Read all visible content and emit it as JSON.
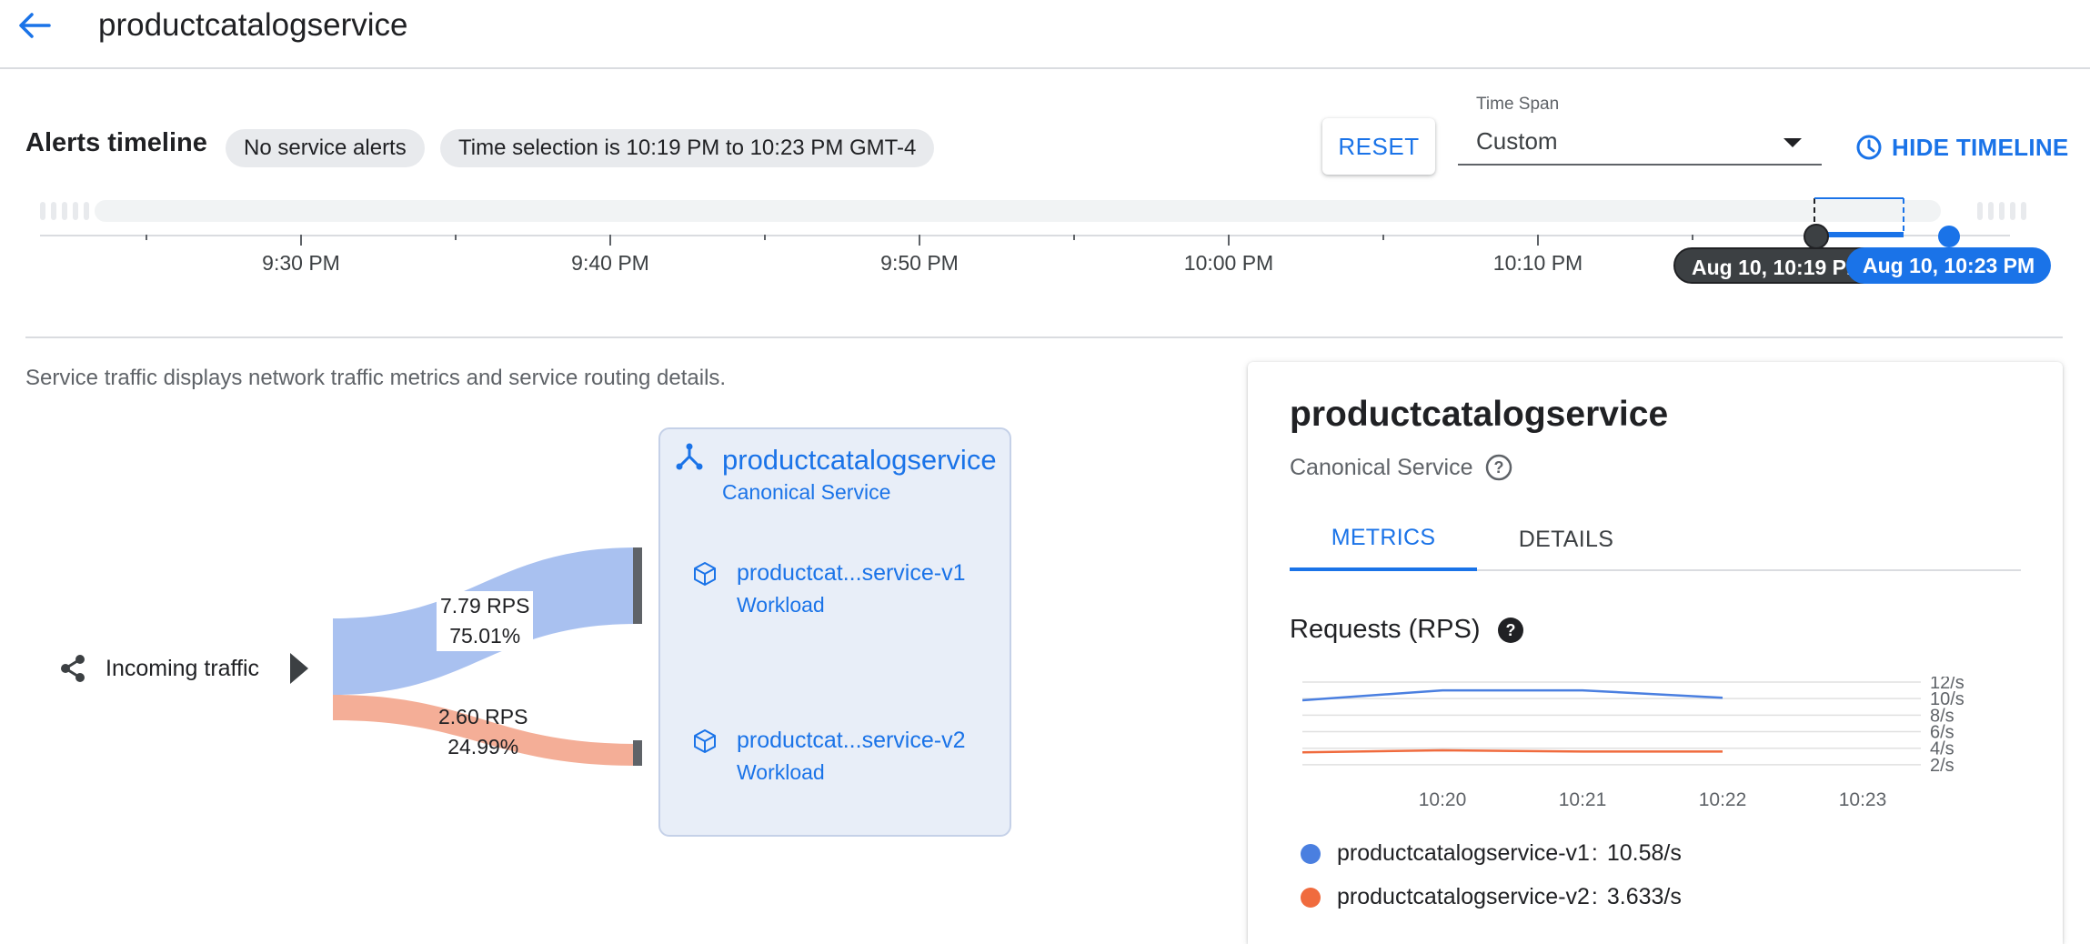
{
  "header": {
    "title": "productcatalogservice"
  },
  "alerts": {
    "title": "Alerts timeline",
    "chip_alerts": "No service alerts",
    "chip_selection": "Time selection is 10:19 PM to 10:23 PM GMT-4",
    "reset_label": "RESET",
    "timespan_label": "Time Span",
    "timespan_value": "Custom",
    "hide_timeline_label": "HIDE TIMELINE"
  },
  "timeline": {
    "ticks": [
      "9:30 PM",
      "9:40 PM",
      "9:50 PM",
      "10:00 PM",
      "10:10 PM"
    ],
    "start_handle": "Aug 10, 10:19 PM",
    "end_handle": "Aug 10, 10:23 PM"
  },
  "traffic": {
    "description": "Service traffic displays network traffic metrics and service routing details.",
    "incoming_label": "Incoming traffic",
    "flow1_rps": "7.79 RPS",
    "flow1_pct": "75.01%",
    "flow2_rps": "2.60 RPS",
    "flow2_pct": "24.99%",
    "service_name": "productcatalogservice",
    "service_type": "Canonical Service",
    "workloads": [
      {
        "name": "productcat...service-v1",
        "type": "Workload"
      },
      {
        "name": "productcat...service-v2",
        "type": "Workload"
      }
    ]
  },
  "details_panel": {
    "title": "productcatalogservice",
    "subtitle": "Canonical Service",
    "tabs": [
      "METRICS",
      "DETAILS"
    ],
    "active_tab": "METRICS",
    "requests_title": "Requests (RPS)"
  },
  "colors": {
    "accent": "#1a73e8",
    "v1": "#4a7fe0",
    "v2": "#f06b3e",
    "flow1": "#a9c1f0",
    "flow2": "#f4ae97"
  },
  "chart_data": {
    "type": "line",
    "title": "Requests (RPS)",
    "xlabel": "",
    "ylabel": "",
    "x": [
      "10:20",
      "10:21",
      "10:22",
      "10:23"
    ],
    "x_start": "10:19",
    "y_ticks": [
      "12/s",
      "10/s",
      "8/s",
      "6/s",
      "4/s",
      "2/s"
    ],
    "ylim": [
      1,
      12
    ],
    "series": [
      {
        "name": "productcatalogservice-v1",
        "color": "#4a7fe0",
        "points": [
          [
            0,
            9.8
          ],
          [
            1,
            11.0
          ],
          [
            2,
            11.0
          ],
          [
            3,
            10.1
          ]
        ],
        "legend_value": "10.58/s"
      },
      {
        "name": "productcatalogservice-v2",
        "color": "#f06b3e",
        "points": [
          [
            0,
            3.5
          ],
          [
            1,
            3.75
          ],
          [
            2,
            3.6
          ],
          [
            3,
            3.6
          ]
        ],
        "legend_value": "3.633/s"
      }
    ],
    "grid": true,
    "legend": "bottom"
  }
}
